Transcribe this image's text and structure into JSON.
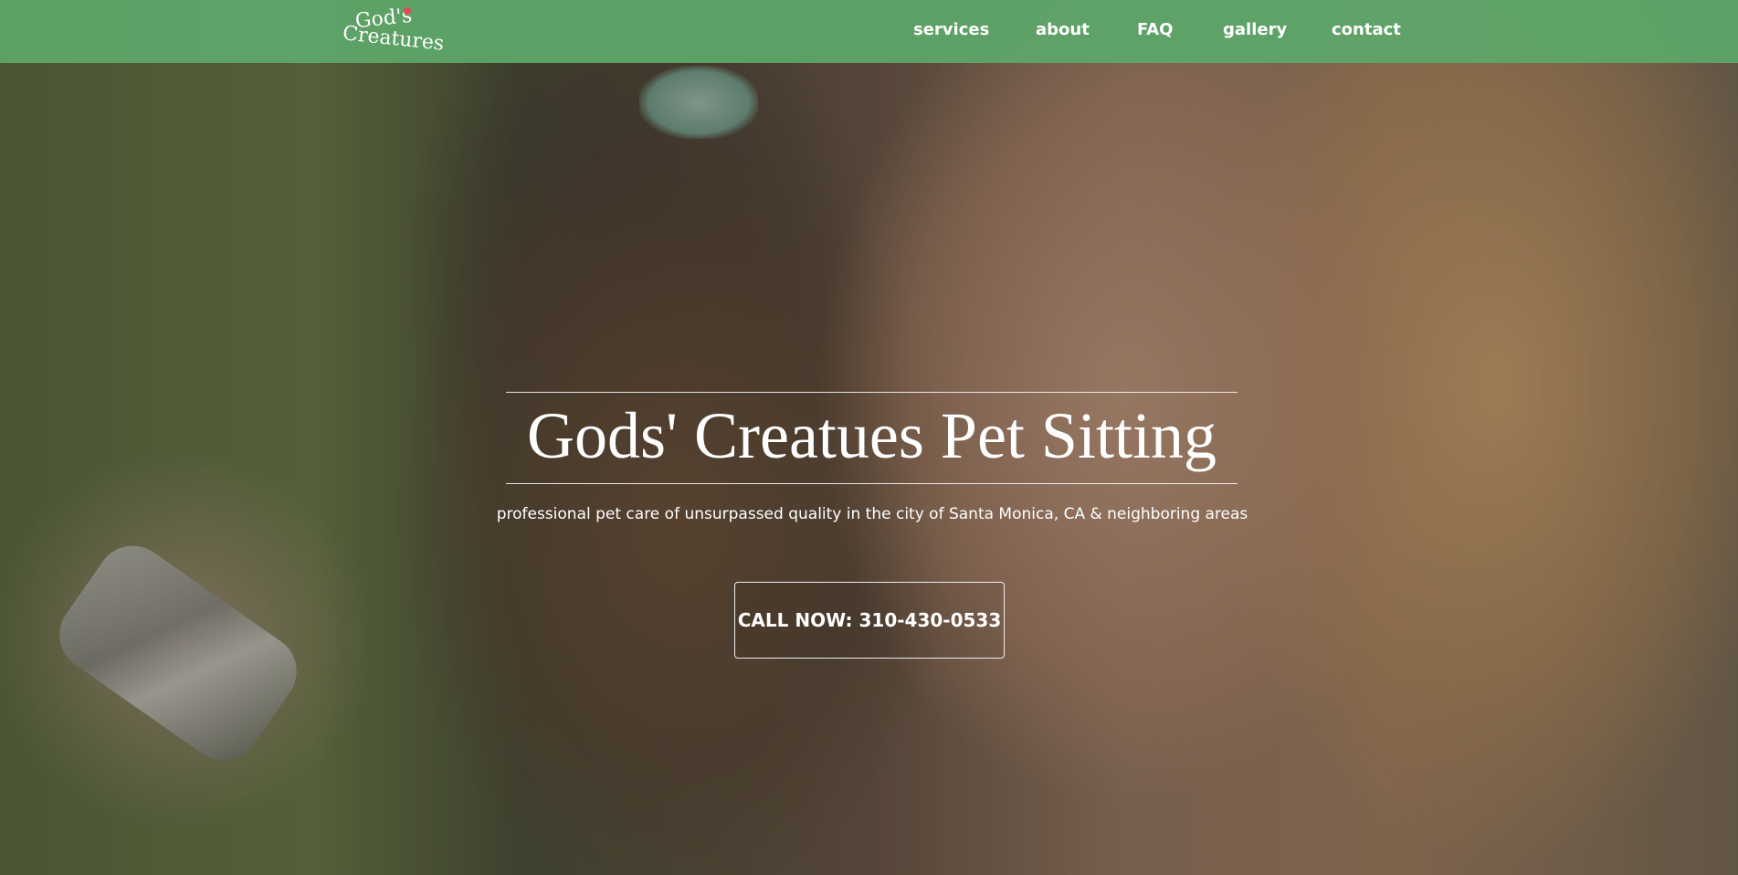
{
  "header": {
    "logo": {
      "line1": "God's",
      "line2": "Creatures"
    },
    "nav": [
      {
        "label": "services"
      },
      {
        "label": "about"
      },
      {
        "label": "FAQ"
      },
      {
        "label": "gallery"
      },
      {
        "label": "contact"
      }
    ]
  },
  "hero": {
    "title": "Gods' Creatues Pet Sitting",
    "subtitle": "professional pet care of unsurpassed quality in the city of Santa Monica, CA & neighboring areas",
    "cta_label": "CALL NOW: 310-430-0533"
  },
  "colors": {
    "header_bg": "#5ea568",
    "text": "#ffffff",
    "logo_heart": "#e24a5a"
  }
}
